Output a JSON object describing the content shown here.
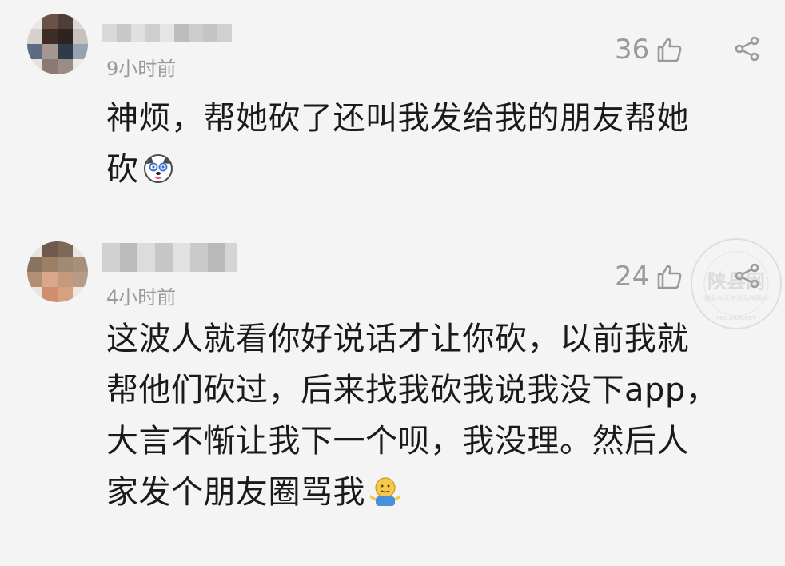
{
  "comments": [
    {
      "time": "9小时前",
      "likes": "36",
      "lines": [
        "神烦，帮她砍了还叫我发给我的朋友帮她",
        "砍"
      ],
      "emoji": "dizzy-dog-face",
      "avatar_colors": [
        "#e9e6e4",
        "#6b5247",
        "#4e3e39",
        "#dcd8d6",
        "#d8d2cf",
        "#3e2c27",
        "#2f2320",
        "#c7c0bd",
        "#5d6c83",
        "#a49891",
        "#2f3b4b",
        "#96a1b2",
        "#e5e2e1",
        "#8b7a74",
        "#9c8c86",
        "#ebe8e6"
      ]
    },
    {
      "time": "4小时前",
      "likes": "24",
      "lines": [
        "这波人就看你好说话才让你砍，以前我就",
        "帮他们砍过，后来找我砍我说我没下app，",
        "大言不惭让我下一个呗，我没理。然后人",
        "家发个朋友圈骂我"
      ],
      "emoji": "shrug-face",
      "avatar_colors": [
        "#e6e3e1",
        "#6d5a4d",
        "#7d6856",
        "#e7e4e2",
        "#8a7261",
        "#9d7f66",
        "#a08a76",
        "#a98f7a",
        "#b08f74",
        "#dba78a",
        "#c39a7c",
        "#b89b86",
        "#e7e4e2",
        "#cf8f6f",
        "#d5a181",
        "#ebe8e6"
      ]
    }
  ],
  "watermark": {
    "title": "陕县网",
    "subtitle": "陕县生活资讯品牌网站",
    "arc": "MOLIHUA.NET"
  },
  "colors": {
    "background": "#f4f4f4",
    "meta": "#9a9a9a",
    "text": "#1a1a1a"
  }
}
